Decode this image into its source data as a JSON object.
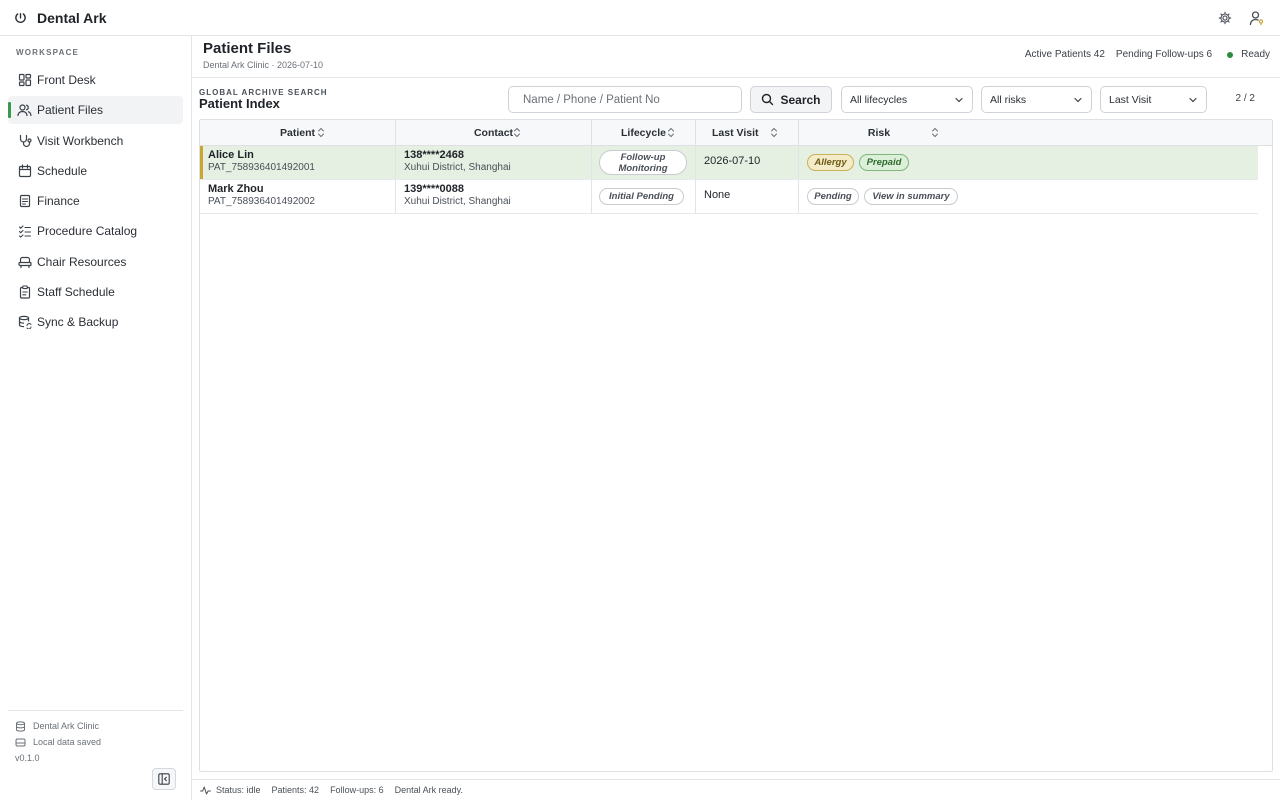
{
  "app": {
    "title": "Dental Ark"
  },
  "titlebar": {
    "icons": [
      "gear-icon",
      "user-key-icon"
    ]
  },
  "sidebar": {
    "section_label": "WORKSPACE",
    "items": [
      {
        "label": "Front Desk",
        "icon": "dashboard-icon",
        "active": false
      },
      {
        "label": "Patient Files",
        "icon": "users-icon",
        "active": true
      },
      {
        "label": "Visit Workbench",
        "icon": "stethoscope-icon",
        "active": false
      },
      {
        "label": "Schedule",
        "icon": "calendar-icon",
        "active": false
      },
      {
        "label": "Finance",
        "icon": "document-icon",
        "active": false
      },
      {
        "label": "Procedure Catalog",
        "icon": "checklist-icon",
        "active": false
      },
      {
        "label": "Chair Resources",
        "icon": "chair-icon",
        "active": false
      },
      {
        "label": "Staff Schedule",
        "icon": "clipboard-icon",
        "active": false
      },
      {
        "label": "Sync & Backup",
        "icon": "database-sync-icon",
        "active": false
      }
    ],
    "footer": {
      "clinic": "Dental Ark Clinic",
      "storage": "Local data saved",
      "version": "v0.1.0"
    }
  },
  "header": {
    "title": "Patient Files",
    "subtitle": "Dental Ark Clinic · 2026-07-10",
    "active_patients": "Active Patients 42",
    "pending_followups": "Pending Follow-ups 6",
    "status": "Ready",
    "status_color": "#2e8b3d"
  },
  "toolbar": {
    "label_small": "GLOBAL ARCHIVE SEARCH",
    "label_big": "Patient Index",
    "search_placeholder": "Name / Phone / Patient No",
    "search_value": "",
    "search_button": "Search",
    "lifecycle_filter": "All lifecycles",
    "risk_filter": "All risks",
    "sort_by": "Last Visit",
    "pager": "2 / 2"
  },
  "table": {
    "columns": [
      "Patient",
      "Contact",
      "Lifecycle",
      "Last Visit",
      "Risk"
    ],
    "rows": [
      {
        "name": "Alice Lin",
        "patient_no": "PAT_758936401492001",
        "phone": "138****2468",
        "address": "Xuhui District, Shanghai",
        "lifecycle": "Follow-up Monitoring",
        "last_visit": "2026-07-10",
        "risks": [
          "Allergy",
          "Prepaid"
        ]
      },
      {
        "name": "Mark Zhou",
        "patient_no": "PAT_758936401492002",
        "phone": "139****0088",
        "address": "Xuhui District, Shanghai",
        "lifecycle": "Initial Pending",
        "last_visit": "None",
        "risks": [
          "Pending",
          "View in summary"
        ]
      }
    ]
  },
  "statusbar": {
    "status": "Status: idle",
    "patients": "Patients: 42",
    "followups": "Follow-ups: 6",
    "message": "Dental Ark ready."
  },
  "colors": {
    "accent": "#3a9a4c",
    "selected_row": "#e5efe2",
    "selected_marker": "#c9a531",
    "allergy": "#f4ecc8",
    "prepaid": "#dcefd8"
  }
}
